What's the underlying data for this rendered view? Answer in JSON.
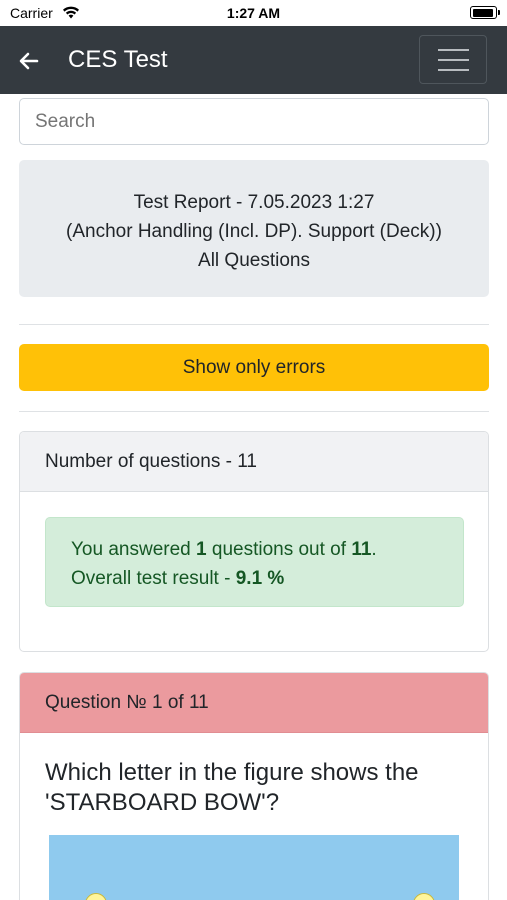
{
  "status_bar": {
    "carrier": "Carrier",
    "time": "1:27 AM"
  },
  "navbar": {
    "title": "CES Test"
  },
  "search": {
    "placeholder": "Search"
  },
  "report": {
    "line1": "Test Report - 7.05.2023 1:27",
    "line2": "(Anchor Handling (Incl. DP). Support (Deck))",
    "line3": "All Questions"
  },
  "filter": {
    "show_errors_label": "Show only errors"
  },
  "summary": {
    "header": "Number of questions - 11",
    "answered_prefix": "You answered ",
    "answered_count": "1",
    "answered_middle": " questions out of ",
    "total_count": "11",
    "answered_suffix": ".",
    "result_prefix": "Overall test result - ",
    "result_value": "9.1 %"
  },
  "question_card": {
    "header": "Question № 1 of 11",
    "text": "Which letter in the figure shows the 'STARBOARD BOW'?"
  },
  "colors": {
    "navbar": "#343a40",
    "warning": "#ffc107",
    "success_bg": "#d4edda",
    "success_text": "#155724",
    "danger_header": "#eb9a9e",
    "figure_bg": "#8fcaee"
  }
}
